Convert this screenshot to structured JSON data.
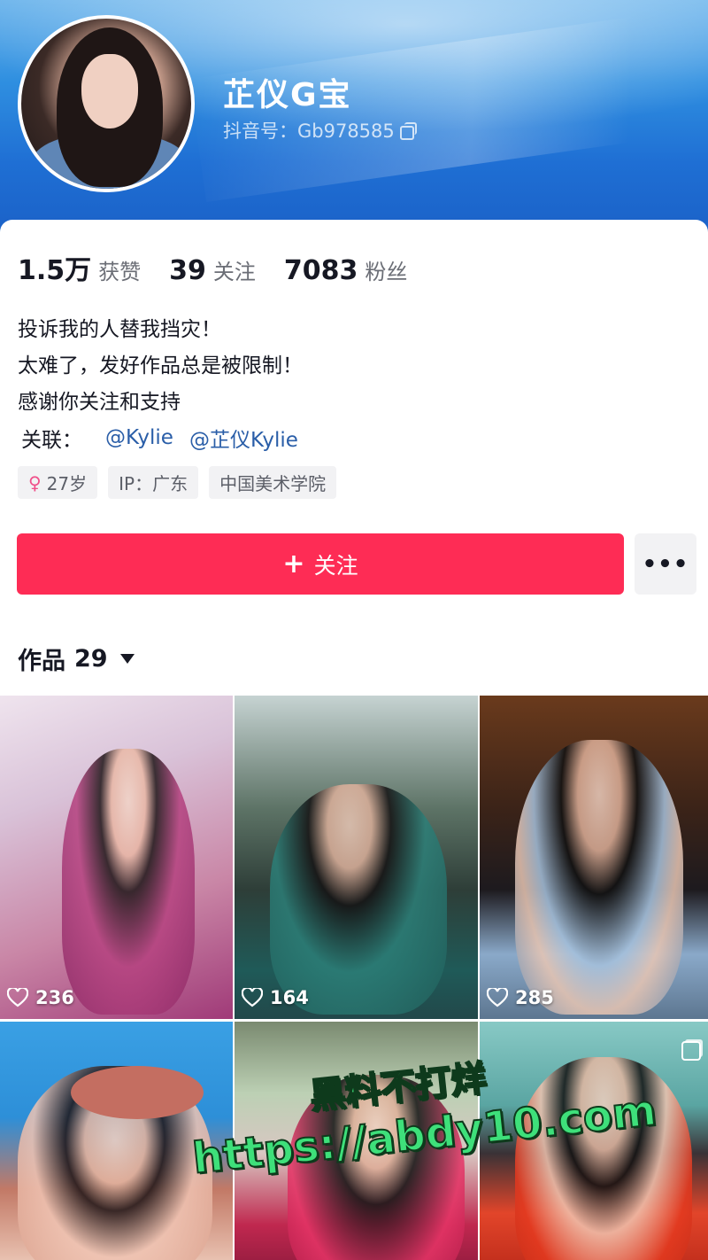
{
  "profile": {
    "name": "芷仪G宝",
    "douyin_id": "抖音号：Gb978585"
  },
  "stats": [
    {
      "value": "1.5万",
      "label": "获赞"
    },
    {
      "value": "39",
      "label": "关注"
    },
    {
      "value": "7083",
      "label": "粉丝"
    }
  ],
  "bio": {
    "line1": "投诉我的人替我挡灾！",
    "line2": "太难了，发好作品总是被限制！",
    "line3": "感谢你关注和支持"
  },
  "related": {
    "label": "关联：",
    "links": [
      "@Kylie",
      "@芷仪Kylie"
    ]
  },
  "tags": {
    "age": "27岁",
    "ip": "IP：广东",
    "school": "中国美术学院"
  },
  "actions": {
    "follow_label": "关注",
    "more_label": "•••"
  },
  "works": {
    "title": "作品",
    "count": "29"
  },
  "posts": [
    {
      "likes": "236"
    },
    {
      "likes": "164"
    },
    {
      "likes": "285"
    },
    {
      "likes": ""
    },
    {
      "likes": ""
    },
    {
      "likes": ""
    }
  ],
  "watermark": {
    "line1": "黑料不打烊",
    "line2": "https://abdy10.com"
  },
  "colors": {
    "follow_button": "#fe2c55",
    "link": "#2a5ea8",
    "banner": "#1f6fd4",
    "watermark": "#3ee07a"
  },
  "icons": [
    "copy-icon",
    "female-icon",
    "plus-icon",
    "more-icon",
    "caret-down-icon",
    "heart-icon",
    "multi-image-icon"
  ]
}
